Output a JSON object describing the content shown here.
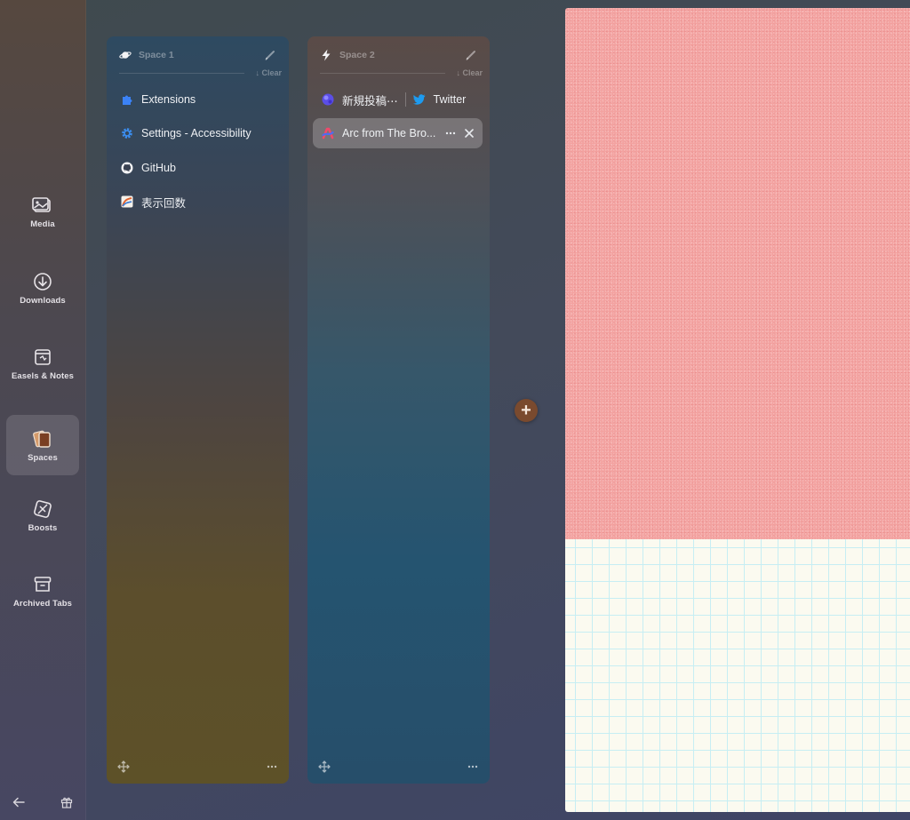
{
  "sidebar": {
    "items": [
      {
        "label": "Media",
        "icon": "media-icon"
      },
      {
        "label": "Downloads",
        "icon": "download-icon"
      },
      {
        "label": "Easels & Notes",
        "icon": "easel-icon"
      },
      {
        "label": "Spaces",
        "icon": "spaces-icon",
        "active": true
      },
      {
        "label": "Boosts",
        "icon": "boost-icon"
      },
      {
        "label": "Archived Tabs",
        "icon": "archive-icon"
      }
    ],
    "bottom": {
      "back_icon": "arrow-left-icon",
      "gift_icon": "gift-icon"
    }
  },
  "spaces": [
    {
      "name": "Space 1",
      "icon": "planet-icon",
      "clear_label": "Clear",
      "tabs": [
        {
          "title": "Extensions",
          "icon": "puzzle-icon"
        },
        {
          "title": "Settings - Accessibility",
          "icon": "gear-icon"
        },
        {
          "title": "GitHub",
          "icon": "github-icon"
        },
        {
          "title": "表示回数",
          "icon": "chart-favicon"
        }
      ],
      "colors": {
        "top": "#2e4a61",
        "bottom": "#5d5128"
      }
    },
    {
      "name": "Space 2",
      "icon": "bolt-icon",
      "clear_label": "Clear",
      "split_tab": {
        "left_title": "新規投稿⋯",
        "right_title": "Twitter"
      },
      "tabs": [
        {
          "title": "Arc from The Bro...",
          "icon": "arc-icon",
          "selected": true
        }
      ],
      "colors": {
        "top": "#5a4b47",
        "bottom": "#264e6a"
      }
    }
  ],
  "add_space": {
    "label": "+"
  },
  "colors": {
    "accent_add": "#7a4a2e",
    "twitter": "#1d9bf0",
    "puzzle": "#3b82f6"
  }
}
